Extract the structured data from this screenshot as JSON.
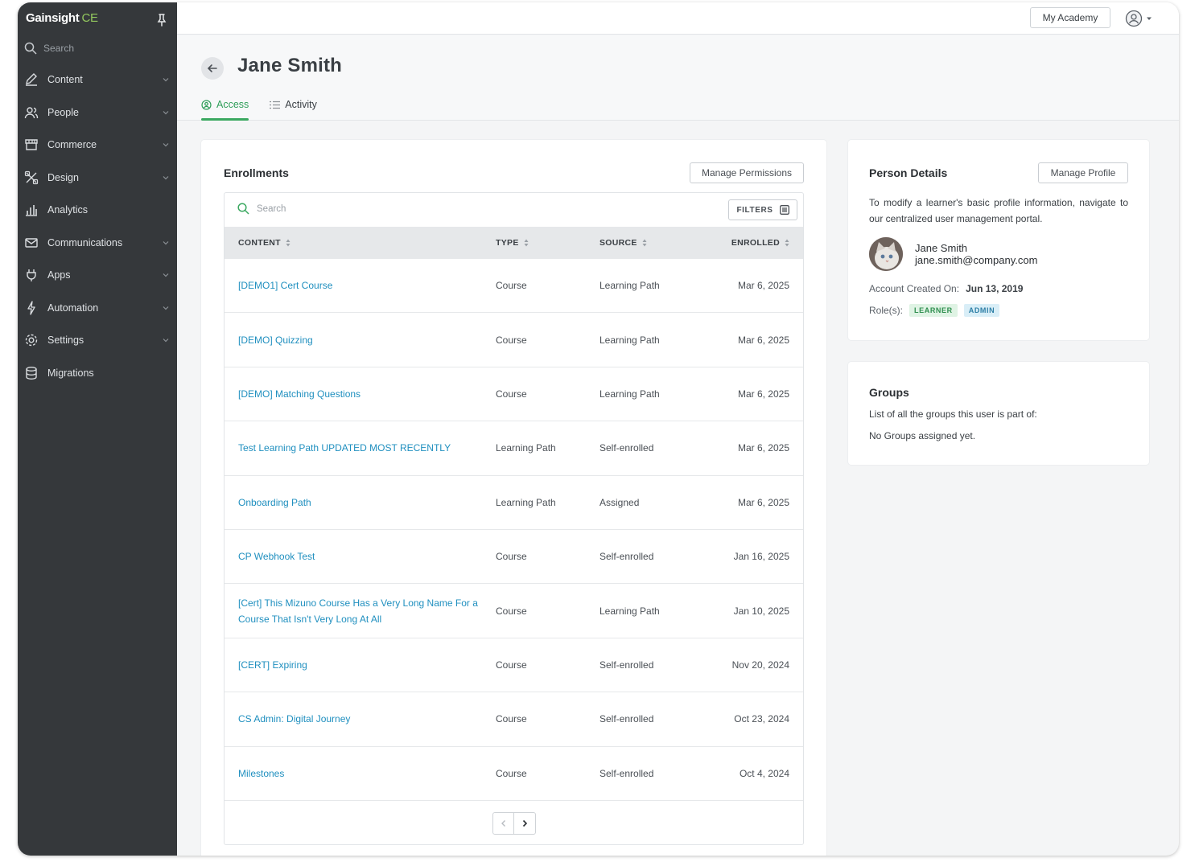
{
  "brand": {
    "name": "Gainsight",
    "suffix": "CE"
  },
  "sidebar": {
    "search_placeholder": "Search",
    "items": [
      {
        "label": "Content",
        "icon": "pen-icon",
        "expandable": true
      },
      {
        "label": "People",
        "icon": "people-icon",
        "expandable": true
      },
      {
        "label": "Commerce",
        "icon": "store-icon",
        "expandable": true
      },
      {
        "label": "Design",
        "icon": "design-tools-icon",
        "expandable": true
      },
      {
        "label": "Analytics",
        "icon": "bar-chart-icon",
        "expandable": false
      },
      {
        "label": "Communications",
        "icon": "mail-icon",
        "expandable": true
      },
      {
        "label": "Apps",
        "icon": "plug-icon",
        "expandable": true
      },
      {
        "label": "Automation",
        "icon": "bolt-icon",
        "expandable": true
      },
      {
        "label": "Settings",
        "icon": "gear-icon",
        "expandable": true
      },
      {
        "label": "Migrations",
        "icon": "database-icon",
        "expandable": false
      }
    ]
  },
  "topbar": {
    "academy_label": "My Academy"
  },
  "header": {
    "title": "Jane Smith",
    "tabs": [
      {
        "label": "Access",
        "active": true
      },
      {
        "label": "Activity",
        "active": false
      }
    ]
  },
  "enrollments": {
    "title": "Enrollments",
    "manage_label": "Manage Permissions",
    "search_placeholder": "Search",
    "filters_label": "FILTERS",
    "columns": {
      "content": "CONTENT",
      "type": "TYPE",
      "source": "SOURCE",
      "enrolled": "ENROLLED"
    },
    "rows": [
      {
        "content": "[DEMO1] Cert Course",
        "type": "Course",
        "source": "Learning Path",
        "enrolled": "Mar 6, 2025"
      },
      {
        "content": "[DEMO] Quizzing",
        "type": "Course",
        "source": "Learning Path",
        "enrolled": "Mar 6, 2025"
      },
      {
        "content": "[DEMO] Matching Questions",
        "type": "Course",
        "source": "Learning Path",
        "enrolled": "Mar 6, 2025"
      },
      {
        "content": "Test Learning Path UPDATED MOST RECENTLY",
        "type": "Learning Path",
        "source": "Self-enrolled",
        "enrolled": "Mar 6, 2025"
      },
      {
        "content": "Onboarding Path",
        "type": "Learning Path",
        "source": "Assigned",
        "enrolled": "Mar 6, 2025"
      },
      {
        "content": "CP Webhook Test",
        "type": "Course",
        "source": "Self-enrolled",
        "enrolled": "Jan 16, 2025"
      },
      {
        "content": "[Cert] This Mizuno Course Has a Very Long Name For a Course That Isn't Very Long At All",
        "type": "Course",
        "source": "Learning Path",
        "enrolled": "Jan 10, 2025"
      },
      {
        "content": "[CERT] Expiring",
        "type": "Course",
        "source": "Self-enrolled",
        "enrolled": "Nov 20, 2024"
      },
      {
        "content": "CS Admin: Digital Journey",
        "type": "Course",
        "source": "Self-enrolled",
        "enrolled": "Oct 23, 2024"
      },
      {
        "content": "Milestones",
        "type": "Course",
        "source": "Self-enrolled",
        "enrolled": "Oct 4, 2024"
      }
    ]
  },
  "person": {
    "title": "Person Details",
    "manage_label": "Manage Profile",
    "description": "To modify a learner's basic profile information, navigate to our centralized user management portal.",
    "name": "Jane Smith",
    "email": "jane.smith@company.com",
    "created_label": "Account Created On:",
    "created_value": "Jun 13, 2019",
    "roles_label": "Role(s):",
    "roles": [
      "LEARNER",
      "ADMIN"
    ]
  },
  "groups": {
    "title": "Groups",
    "subtitle": "List of all the groups this user is part of:",
    "empty": "No Groups assigned yet."
  },
  "colors": {
    "sidebar": "#35383b",
    "accent_green": "#3aa860",
    "link_blue": "#1f8fbf"
  }
}
